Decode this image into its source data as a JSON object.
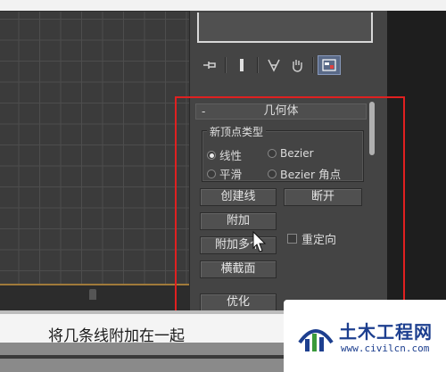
{
  "rollout": {
    "collapse_symbol": "-",
    "title": "几何体"
  },
  "vertex_group": {
    "label": "新顶点类型",
    "options": [
      {
        "label": "线性",
        "checked": true
      },
      {
        "label": "Bezier",
        "checked": false
      },
      {
        "label": "平滑",
        "checked": false
      },
      {
        "label": "Bezier 角点",
        "checked": false
      }
    ]
  },
  "buttons": {
    "create_line": "创建线",
    "break": "断开",
    "attach": "附加",
    "attach_multiple": "附加多个",
    "cross_section": "横截面",
    "optimize": "优化"
  },
  "reorient": {
    "label": "重定向",
    "checked": false
  },
  "toolbar": {
    "icons": [
      "pin-stack-icon",
      "modifier-bar-icon",
      "funnel-icon",
      "hand-icon",
      "configure-sets-icon"
    ]
  },
  "caption": "将几条线附加在一起",
  "watermark": {
    "title": "土木工程网",
    "url": "www.civilcn.com"
  },
  "colors": {
    "highlight": "#e02020",
    "panel": "#444444",
    "brand": "#1d3f8f"
  }
}
